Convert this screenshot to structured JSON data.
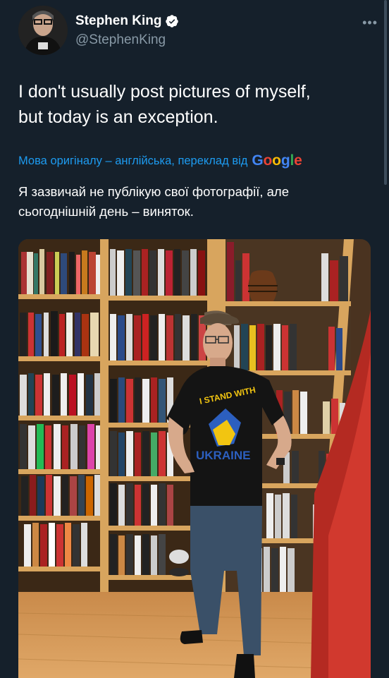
{
  "author": {
    "name": "Stephen King",
    "handle": "@StephenKing",
    "verified": true,
    "avatar_icon": "author-avatar"
  },
  "menu": {
    "more_label": "•••"
  },
  "tweet": {
    "text_line1": "I don't usually post pictures of myself,",
    "text_line2": "but today is an exception."
  },
  "translation": {
    "notice": "Мова оригіналу – англійська, переклад від",
    "provider_letters": [
      "G",
      "o",
      "o",
      "g",
      "l",
      "e"
    ],
    "text_line1": "Я зазвичай не публікую свої фотографії, але",
    "text_line2": "сьогоднішній день – виняток."
  },
  "photo": {
    "shirt_text_line1": "I STAND WITH",
    "shirt_text_line2": "UKRAINE"
  },
  "colors": {
    "background": "#15202b",
    "link": "#1d9bf0",
    "secondary_text": "#8899a6",
    "verified": "#ffffff"
  }
}
